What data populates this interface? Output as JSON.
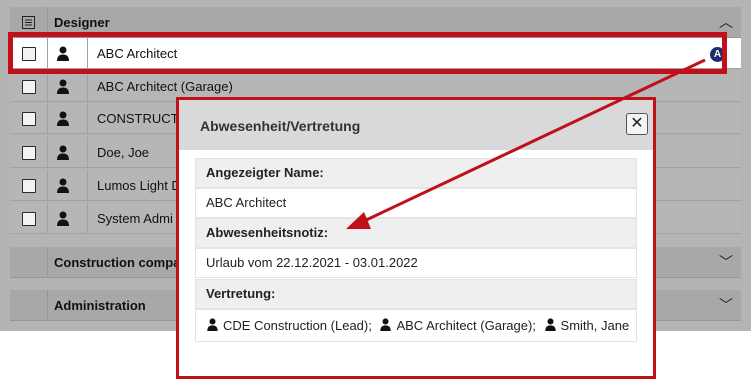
{
  "list": {
    "header_icon": "list-icon",
    "groups": [
      {
        "label": "Designer",
        "chevron": "chevron-up-icon"
      },
      {
        "label": "Construction compa",
        "chevron": "chevron-down-icon"
      },
      {
        "label": "Administration",
        "chevron": "chevron-down-icon"
      }
    ],
    "rows": [
      {
        "name": "ABC Architect",
        "icon": "person-icon",
        "badge": "A"
      },
      {
        "name": "ABC Architect (Garage)",
        "icon": "person-icon"
      },
      {
        "name": "CONSTRUCT-",
        "icon": "person-icon"
      },
      {
        "name": "Doe, Joe",
        "icon": "person-icon"
      },
      {
        "name": "Lumos Light D",
        "icon": "person-icon"
      },
      {
        "name": "System Admi",
        "icon": "person-icon"
      }
    ]
  },
  "dialog": {
    "title": "Abwesenheit/Vertretung",
    "close_icon": "close-icon",
    "fields": {
      "name_label": "Angezeigter Name:",
      "name_value": "ABC Architect",
      "note_label": "Abwesenheitsnotiz:",
      "note_value": "Urlaub vom 22.12.2021 - 03.01.2022",
      "rep_label": "Vertretung:",
      "representatives": [
        "CDE Construction (Lead);",
        "ABC Architect (Garage);",
        "Smith, Jane"
      ]
    }
  },
  "colors": {
    "highlight_red": "#c0101a",
    "panel_gray": "#b4b4b4",
    "badge_navy": "#1d2d6e"
  }
}
